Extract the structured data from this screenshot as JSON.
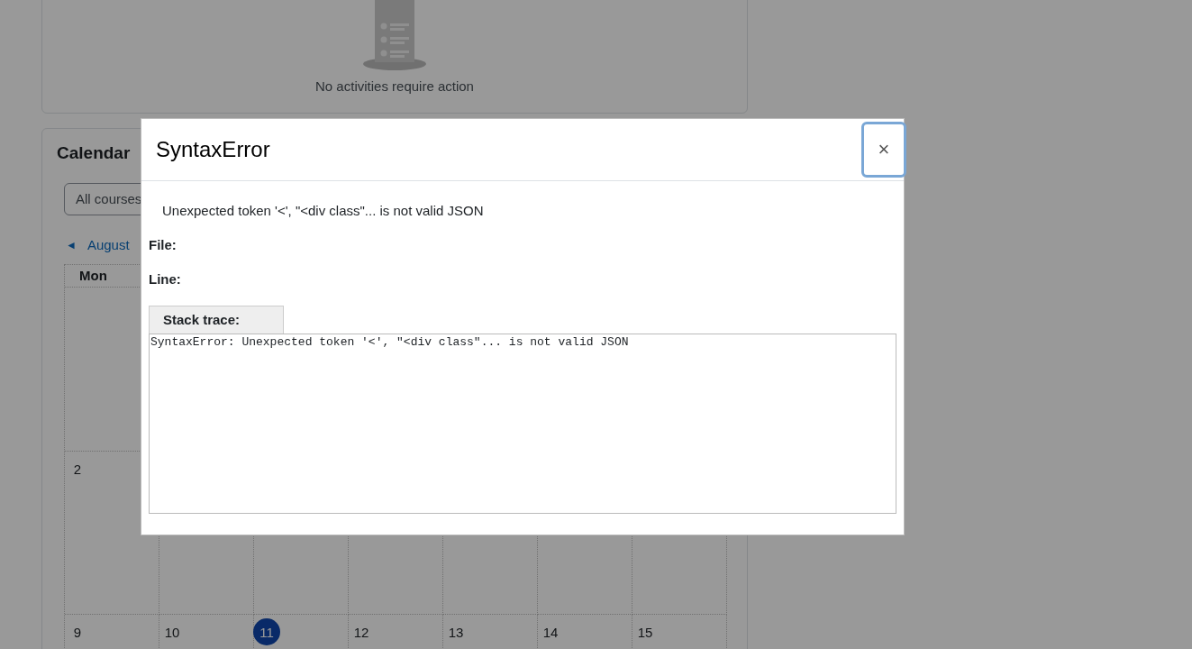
{
  "activities": {
    "empty_message": "No activities require action"
  },
  "calendar": {
    "title": "Calendar",
    "course_filter": "All courses",
    "prev_icon": "◄",
    "prev_month": "August",
    "weekday_header": "Mon",
    "weeks": [
      {
        "days": [
          {
            "label": "2",
            "today": false
          }
        ]
      },
      {
        "days": [
          {
            "label": "9",
            "today": false
          },
          {
            "label": "10",
            "today": false
          },
          {
            "label": "11",
            "today": true
          },
          {
            "label": "12",
            "today": false
          },
          {
            "label": "13",
            "today": false
          },
          {
            "label": "14",
            "today": false
          },
          {
            "label": "15",
            "today": false
          }
        ]
      }
    ]
  },
  "dialog": {
    "title": "SyntaxError",
    "close": "×",
    "message": "Unexpected token '<', \"<div class\"... is not valid JSON",
    "file_label": "File:",
    "line_label": "Line:",
    "stack_tab": "Stack trace:",
    "stack_trace": "SyntaxError: Unexpected token '<', \"<div class\"... is not valid JSON"
  }
}
